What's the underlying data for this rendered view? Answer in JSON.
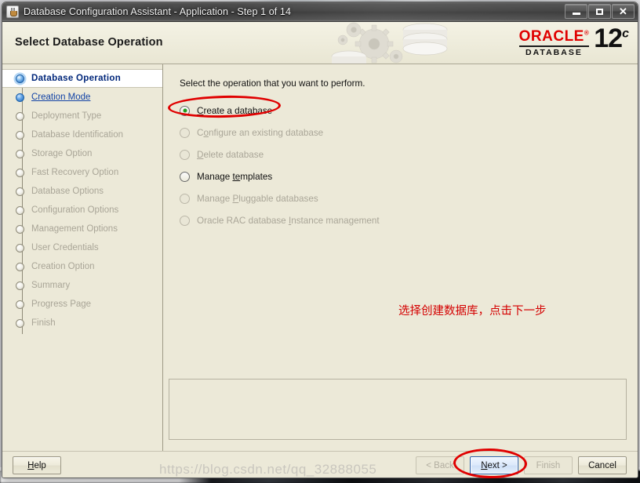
{
  "window": {
    "title": "Database Configuration Assistant - Application - Step 1 of 14",
    "app_icon": "java-coffee-cup-icon",
    "controls": {
      "minimize": "–",
      "maximize": "□",
      "close": "✕"
    }
  },
  "banner": {
    "title": "Select Database Operation",
    "logo": {
      "brand": "ORACLE",
      "trademark": "®",
      "product": "DATABASE",
      "version": "12",
      "version_suffix": "c",
      "brand_color": "#e00000"
    }
  },
  "sidebar": {
    "steps": [
      {
        "label": "Database Operation",
        "state": "active"
      },
      {
        "label": "Creation Mode",
        "state": "done"
      },
      {
        "label": "Deployment Type",
        "state": "pending"
      },
      {
        "label": "Database Identification",
        "state": "pending"
      },
      {
        "label": "Storage Option",
        "state": "pending"
      },
      {
        "label": "Fast Recovery Option",
        "state": "pending"
      },
      {
        "label": "Database Options",
        "state": "pending"
      },
      {
        "label": "Configuration Options",
        "state": "pending"
      },
      {
        "label": "Management Options",
        "state": "pending"
      },
      {
        "label": "User Credentials",
        "state": "pending"
      },
      {
        "label": "Creation Option",
        "state": "pending"
      },
      {
        "label": "Summary",
        "state": "pending"
      },
      {
        "label": "Progress Page",
        "state": "pending"
      },
      {
        "label": "Finish",
        "state": "pending"
      }
    ]
  },
  "main": {
    "instruction": "Select the operation that you want to perform.",
    "options": [
      {
        "label": "Create a database",
        "mnemonic": "C",
        "selected": true,
        "enabled": true
      },
      {
        "label": "Configure an existing database",
        "mnemonic": "o",
        "selected": false,
        "enabled": false
      },
      {
        "label": "Delete database",
        "mnemonic": "D",
        "selected": false,
        "enabled": false
      },
      {
        "label": "Manage templates",
        "mnemonic": "te",
        "selected": false,
        "enabled": true
      },
      {
        "label": "Manage Pluggable databases",
        "mnemonic": "P",
        "selected": false,
        "enabled": false
      },
      {
        "label": "Oracle RAC database Instance management",
        "mnemonic": "I",
        "selected": false,
        "enabled": false
      }
    ],
    "annotation": {
      "text": "选择创建数据库，点击下一步",
      "color": "#d40000"
    },
    "message_panel": ""
  },
  "buttons": {
    "help": "Help",
    "back": "< Back",
    "next": "Next >",
    "finish": "Finish",
    "cancel": "Cancel"
  },
  "watermark": "https://blog.csdn.net/qq_32888055"
}
